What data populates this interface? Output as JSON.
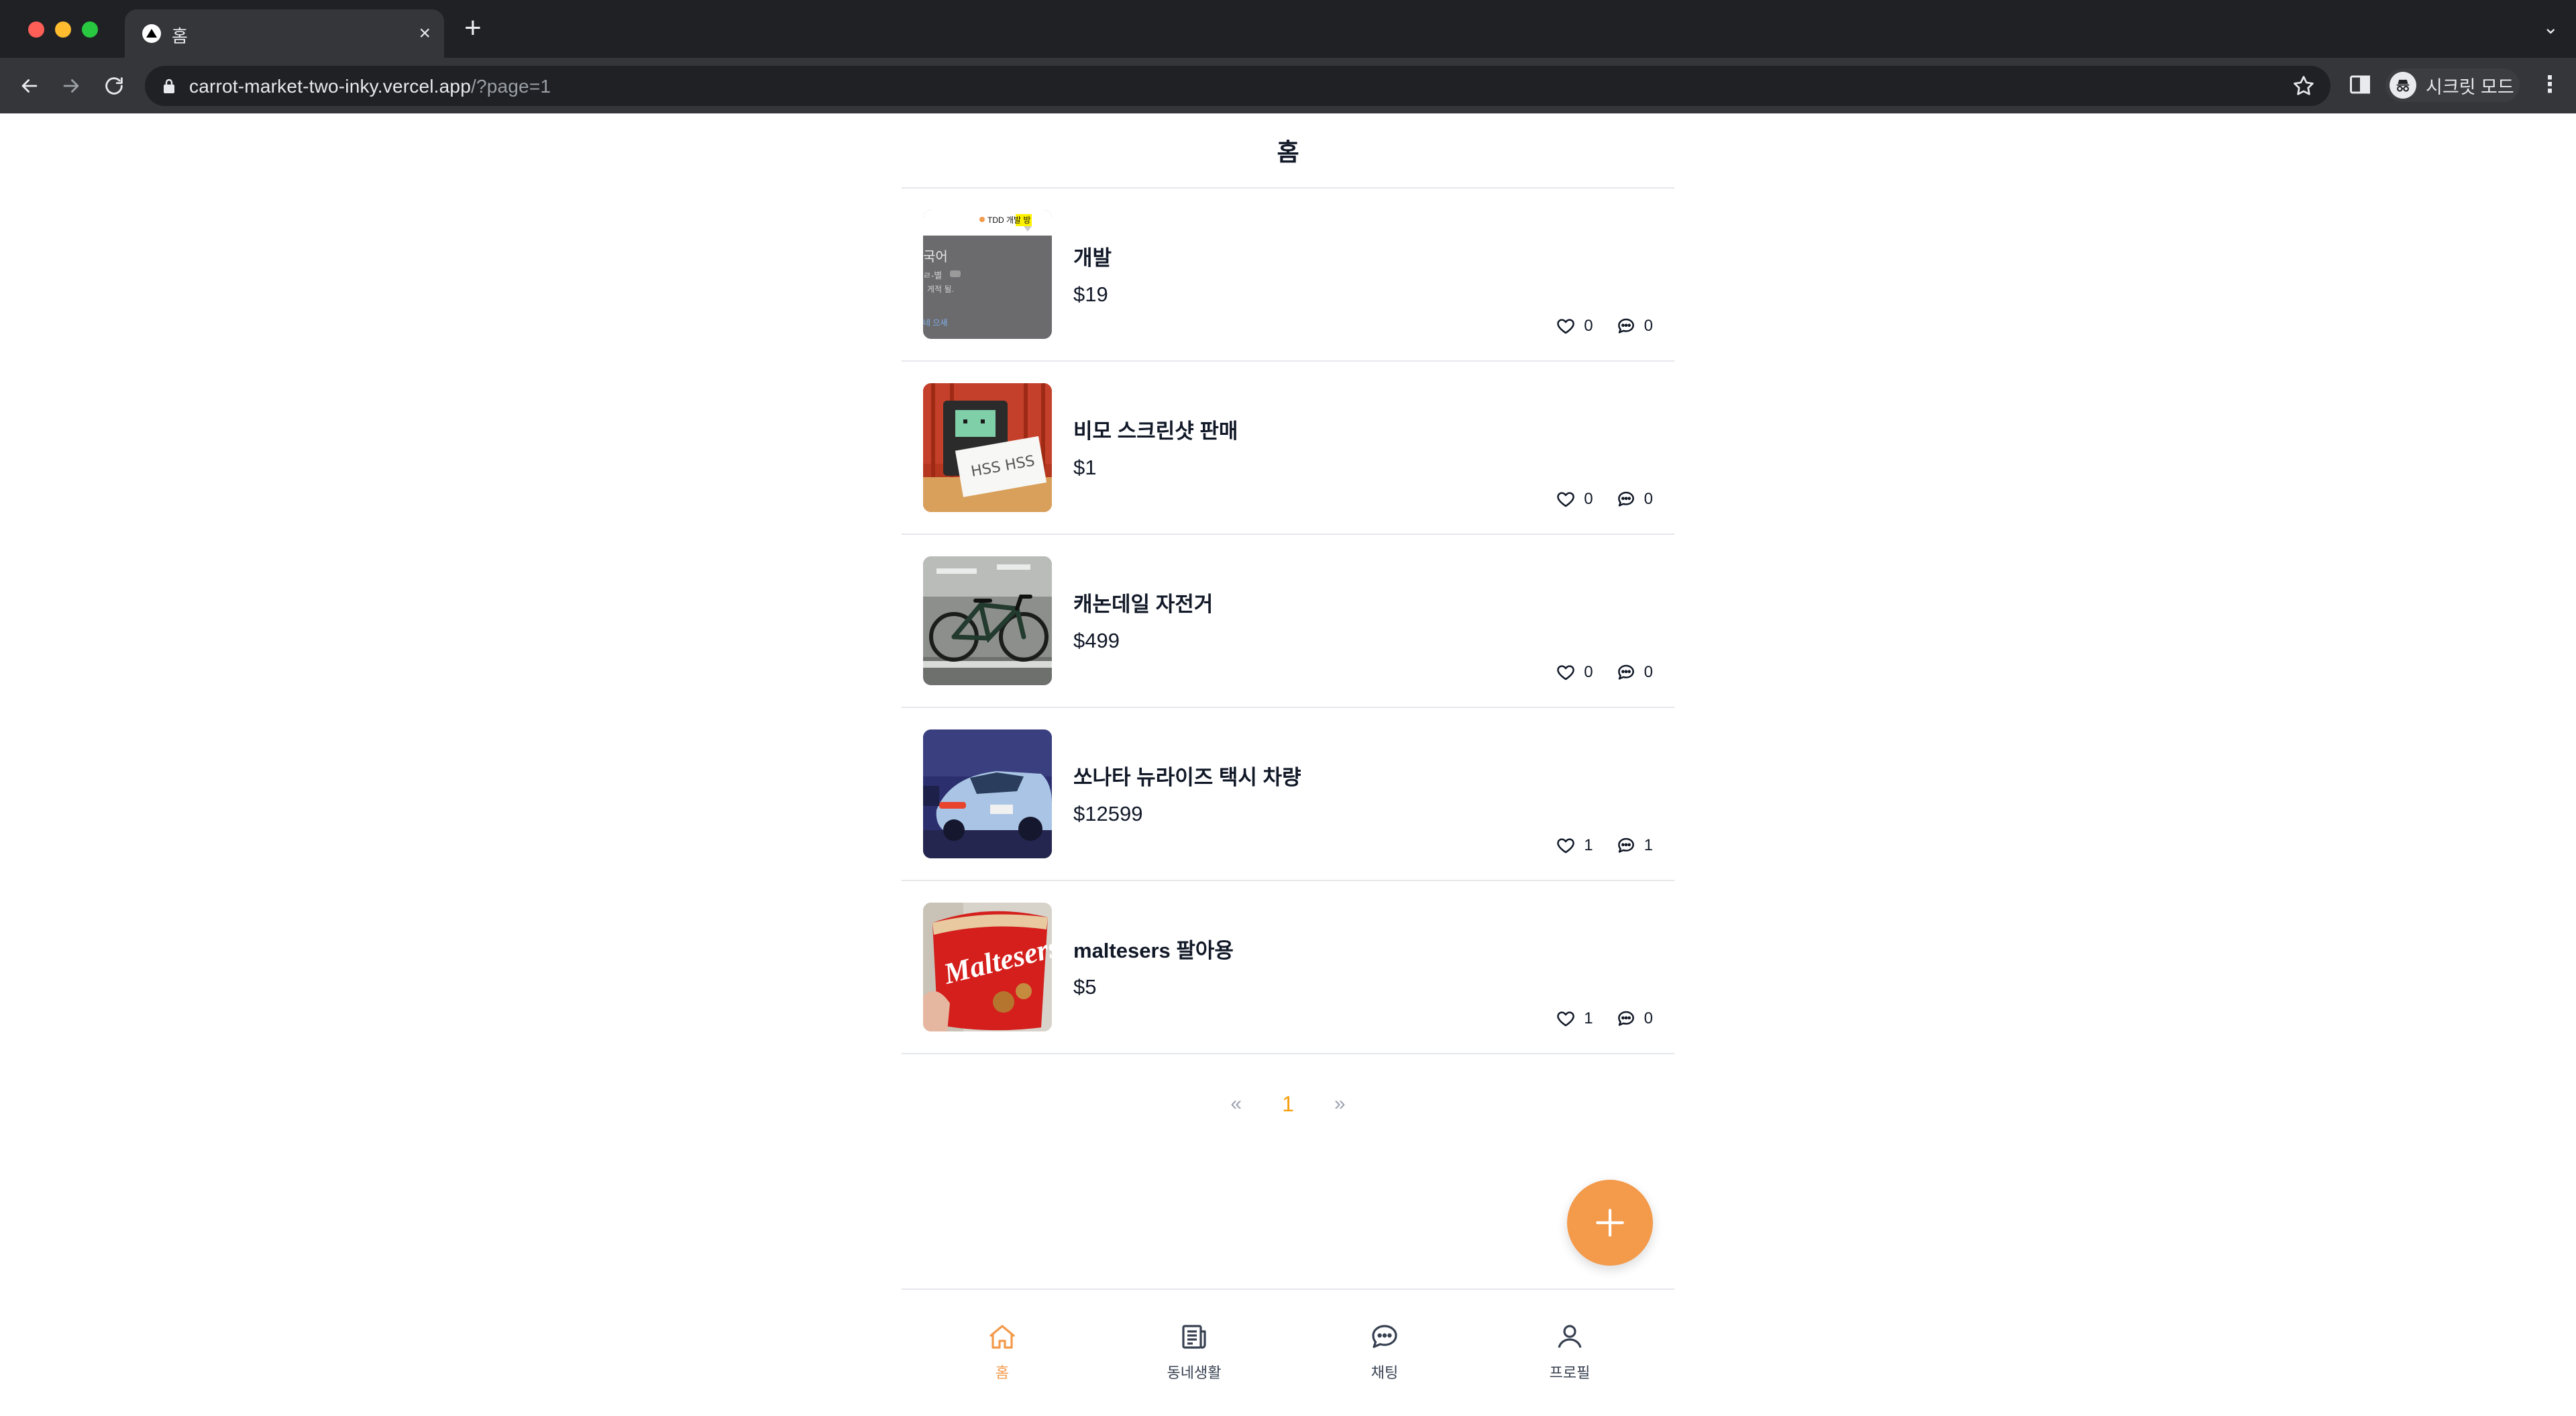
{
  "browser": {
    "tab_title": "홈",
    "tab_close": "×",
    "new_tab": "+",
    "tab_menu": "⌄",
    "url_host": "carrot-market-two-inky.vercel.app",
    "url_path": "/?page=1",
    "incognito_label": "시크릿 모드",
    "menu": "⋮"
  },
  "header": {
    "title": "홈"
  },
  "products": [
    {
      "title": "개발",
      "price": "$19",
      "likes": "0",
      "comments": "0",
      "thumb": "dev-screenshot"
    },
    {
      "title": "비모 스크린샷 판매",
      "price": "$1",
      "likes": "0",
      "comments": "0",
      "thumb": "bmo-figure"
    },
    {
      "title": "캐논데일 자전거",
      "price": "$499",
      "likes": "0",
      "comments": "0",
      "thumb": "bicycle"
    },
    {
      "title": "쏘나타 뉴라이즈 택시 차량",
      "price": "$12599",
      "likes": "1",
      "comments": "1",
      "thumb": "taxi-car"
    },
    {
      "title": "maltesers 팔아용",
      "price": "$5",
      "likes": "1",
      "comments": "0",
      "thumb": "maltesers-bag"
    }
  ],
  "pagination": {
    "prev": "«",
    "current": "1",
    "next": "»"
  },
  "nav": {
    "home": "홈",
    "community": "동네생활",
    "chat": "채팅",
    "profile": "프로필"
  },
  "colors": {
    "accent": "#f39a4b",
    "page_active": "#f59e0b"
  }
}
